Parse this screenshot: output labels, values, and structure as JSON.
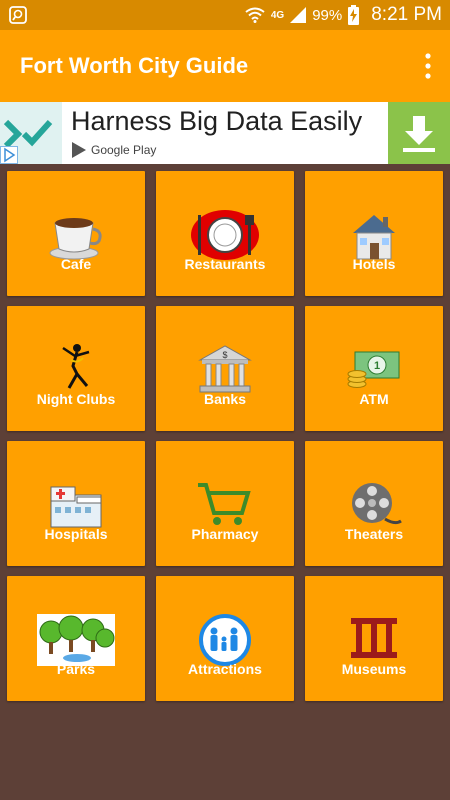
{
  "status_bar": {
    "signal_network": "4G",
    "battery": "99%",
    "time": "8:21 PM"
  },
  "app_bar": {
    "title": "Fort Worth City Guide",
    "overflow_icon": "more-vert-icon"
  },
  "ad": {
    "headline": "Harness Big Data Easily",
    "store_label": "Google Play",
    "colors": {
      "download_bg": "#8bc34a"
    }
  },
  "colors": {
    "background": "#5d4037",
    "tile": "#ffa000",
    "status_bar": "#d88a00"
  },
  "categories": [
    {
      "label": "Cafe",
      "icon": "coffee-cup-icon"
    },
    {
      "label": "Restaurants",
      "icon": "plate-cutlery-icon"
    },
    {
      "label": "Hotels",
      "icon": "house-icon"
    },
    {
      "label": "Night Clubs",
      "icon": "dancer-icon"
    },
    {
      "label": "Banks",
      "icon": "bank-building-icon"
    },
    {
      "label": "ATM",
      "icon": "cash-coins-icon"
    },
    {
      "label": "Hospitals",
      "icon": "hospital-building-icon"
    },
    {
      "label": "Pharmacy",
      "icon": "shopping-cart-icon"
    },
    {
      "label": "Theaters",
      "icon": "film-reel-icon"
    },
    {
      "label": "Parks",
      "icon": "trees-icon"
    },
    {
      "label": "Attractions",
      "icon": "family-icon"
    },
    {
      "label": "Museums",
      "icon": "museum-columns-icon"
    }
  ]
}
